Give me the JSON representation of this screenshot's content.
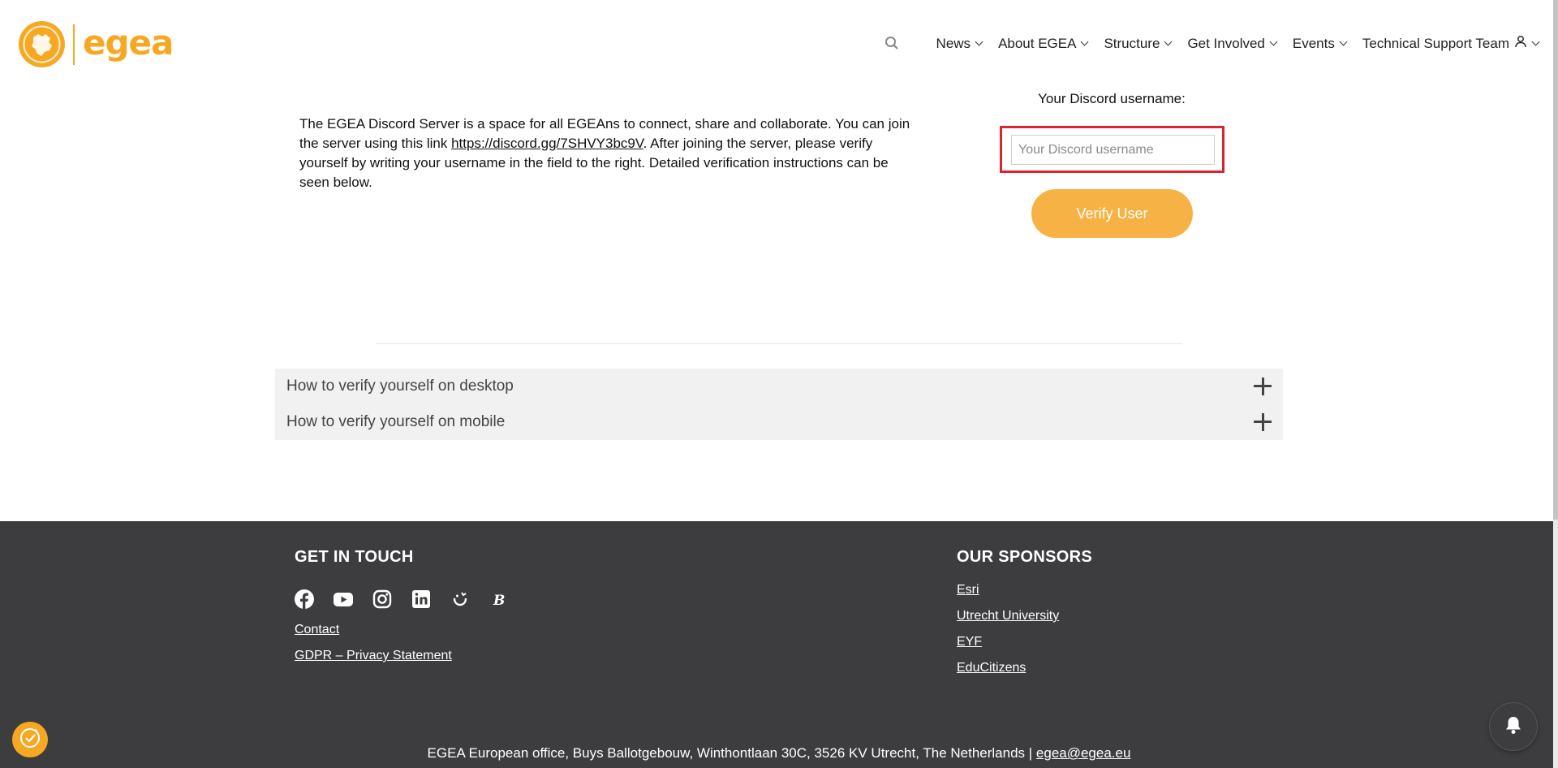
{
  "brand": {
    "logo_text": "egea",
    "accent_color": "#f7a823"
  },
  "nav": {
    "search_icon": "search-icon",
    "items": [
      {
        "label": "News"
      },
      {
        "label": "About EGEA"
      },
      {
        "label": "Structure"
      },
      {
        "label": "Get Involved"
      },
      {
        "label": "Events"
      },
      {
        "label": "Technical Support Team"
      }
    ]
  },
  "main": {
    "intro_before_link": "The EGEA Discord Server is a space for all EGEAns to connect, share and collaborate. You can join the server using this link ",
    "intro_link": "https://discord.gg/7SHVY3bc9V",
    "intro_after_link": ". After joining the server, please verify yourself by writing your username in the field to the right. Detailed verification instructions can be seen below.",
    "form_label": "Your Discord username:",
    "input_placeholder": "Your Discord username",
    "input_value": "",
    "verify_button": "Verify User",
    "highlight_color": "#d9252b"
  },
  "accordion": [
    {
      "title": "How to verify yourself on desktop"
    },
    {
      "title": "How to verify yourself on mobile"
    }
  ],
  "footer": {
    "get_in_touch_heading": "GET IN TOUCH",
    "social_icons": [
      "facebook-icon",
      "youtube-icon",
      "instagram-icon",
      "linkedin-icon",
      "untappd-icon",
      "behance-icon"
    ],
    "links": [
      "Contact",
      "GDPR – Privacy Statement"
    ],
    "sponsors_heading": "OUR SPONSORS",
    "sponsors": [
      "Esri",
      "Utrecht University",
      "EYF",
      "EduCitizens"
    ],
    "address": "EGEA European office, Buys Ballotgebouw, Winthontlaan 30C, 3526 KV Utrecht, The Netherlands | ",
    "email": "egea@egea.eu"
  },
  "floating": {
    "cookie_icon": "cookie-icon",
    "bell_icon": "bell-icon"
  }
}
